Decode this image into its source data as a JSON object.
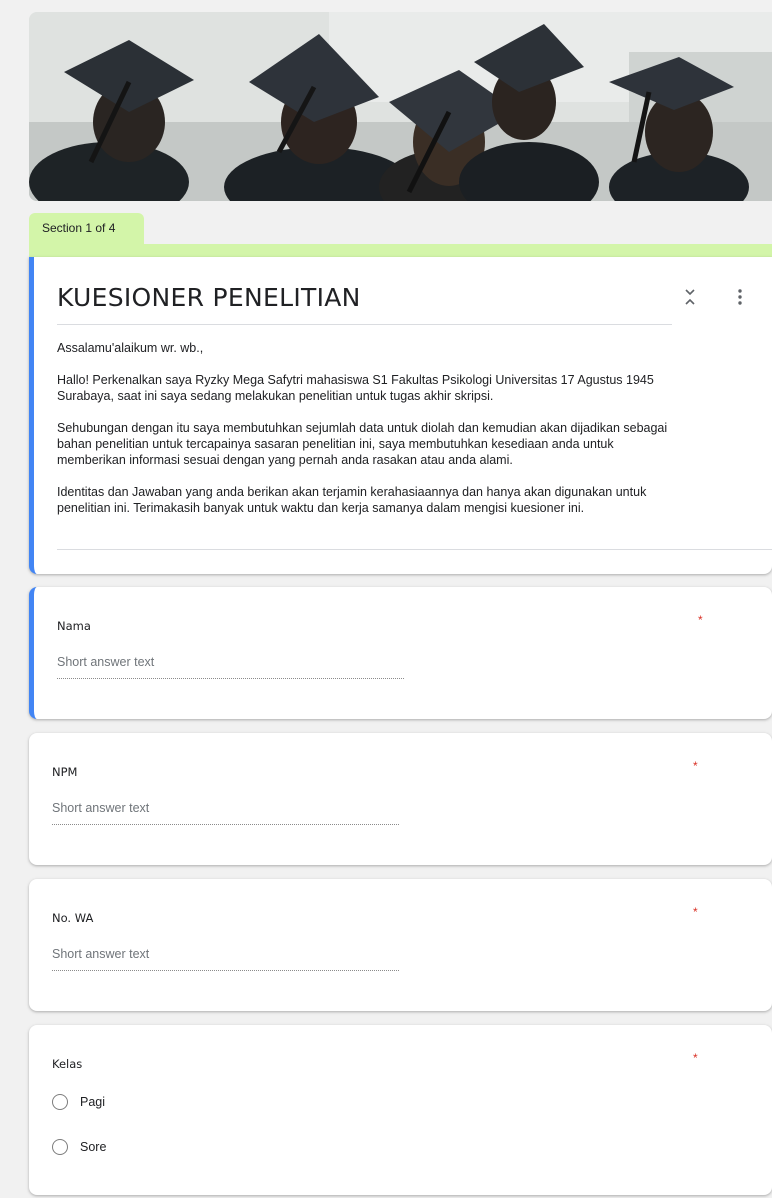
{
  "section": {
    "label": "Section 1 of 4"
  },
  "form": {
    "title": "KUESIONER PENELITIAN",
    "description": [
      "Assalamu'alaikum wr. wb.,",
      "Hallo! Perkenalkan saya Ryzky Mega Safytri mahasiswa S1 Fakultas Psikologi Universitas 17 Agustus 1945\nSurabaya, saat ini saya sedang melakukan penelitian untuk tugas akhir skripsi.",
      "Sehubungan dengan itu saya membutuhkan sejumlah data untuk diolah dan kemudian akan dijadikan sebagai\nbahan penelitian untuk tercapainya sasaran penelitian ini, saya membutuhkan kesediaan anda untuk\nmemberikan informasi sesuai dengan yang pernah anda rasakan atau anda alami.",
      "Identitas dan Jawaban yang anda berikan akan terjamin kerahasiaannya dan hanya akan digunakan untuk\npenelitian ini. Terimakasih banyak untuk waktu dan kerja samanya dalam mengisi kuesioner ini."
    ]
  },
  "questions": [
    {
      "label": "Nama",
      "required": "*",
      "placeholder": "Short answer text"
    },
    {
      "label": "NPM",
      "required": "*",
      "placeholder": "Short answer text"
    },
    {
      "label": "No. WA",
      "required": "*",
      "placeholder": "Short answer text"
    },
    {
      "label": "Kelas",
      "required": "*",
      "options": [
        "Pagi",
        "Sore"
      ]
    }
  ],
  "icons": {
    "collapse": "collapse-icon",
    "more": "more-vert-icon",
    "radio": "radio-unchecked-icon"
  },
  "colors": {
    "accent": "#4285f4",
    "section_tab": "#d3f5a9",
    "required": "#d93025"
  }
}
